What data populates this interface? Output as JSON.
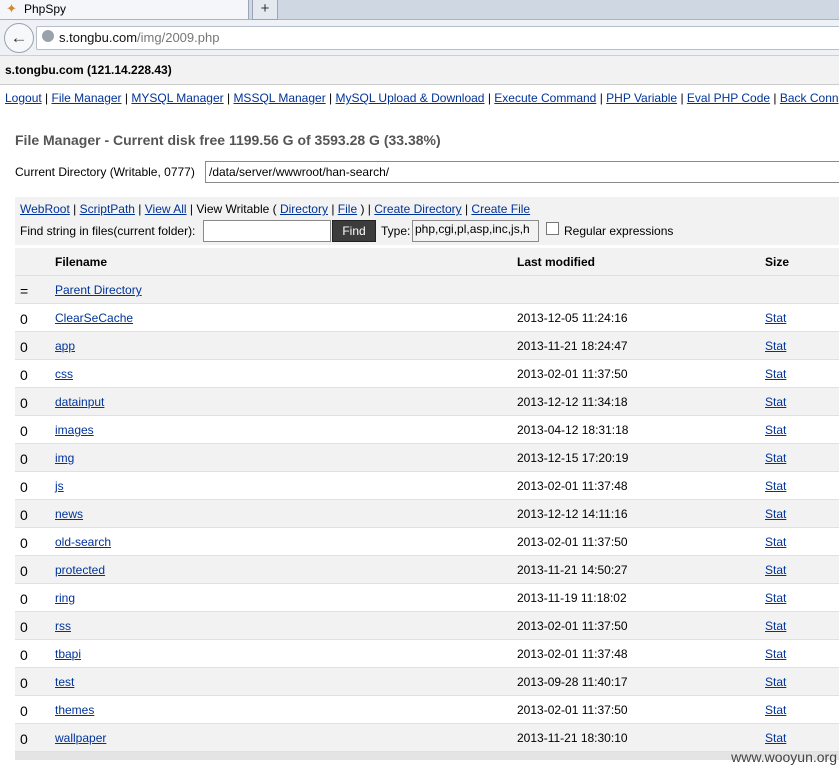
{
  "browser": {
    "tab_title": "PhpSpy",
    "url_host": "s.tongbu.com",
    "url_path": "/img/2009.php"
  },
  "host_info": "s.tongbu.com (121.14.228.43)",
  "menu": [
    "Logout",
    "File Manager",
    "MYSQL Manager",
    "MSSQL Manager",
    "MySQL Upload & Download",
    "Execute Command",
    "PHP Variable",
    "Eval PHP Code",
    "Back Conn"
  ],
  "file_manager": {
    "title": "File Manager - Current disk free 1199.56 G of 3593.28 G (33.38%)",
    "current_dir_label": "Current Directory (Writable, 0777)",
    "current_dir_value": "/data/server/wwwroot/han-search/",
    "tools": {
      "webroot": "WebRoot",
      "scriptpath": "ScriptPath",
      "view_all": "View All",
      "view_writable_prefix": "View Writable (",
      "directory": "Directory",
      "file": "File",
      "view_writable_suffix": ")",
      "create_directory": "Create Directory",
      "create_file": "Create File"
    },
    "find": {
      "label": "Find string in files(current folder):",
      "value": "",
      "button": "Find",
      "type_label": "Type:",
      "type_value": "php,cgi,pl,asp,inc,js,h",
      "regex_label": "Regular expressions",
      "regex_checked": false
    },
    "columns": {
      "filename": "Filename",
      "last_modified": "Last modified",
      "size": "Size"
    },
    "parent": {
      "marker": "=",
      "label": "Parent Directory"
    },
    "rows": [
      {
        "marker": "0",
        "name": "ClearSeCache",
        "modified": "2013-12-05 11:24:16",
        "size": "Stat"
      },
      {
        "marker": "0",
        "name": "app",
        "modified": "2013-11-21 18:24:47",
        "size": "Stat"
      },
      {
        "marker": "0",
        "name": "css",
        "modified": "2013-02-01 11:37:50",
        "size": "Stat"
      },
      {
        "marker": "0",
        "name": "datainput",
        "modified": "2013-12-12 11:34:18",
        "size": "Stat"
      },
      {
        "marker": "0",
        "name": "images",
        "modified": "2013-04-12 18:31:18",
        "size": "Stat"
      },
      {
        "marker": "0",
        "name": "img",
        "modified": "2013-12-15 17:20:19",
        "size": "Stat"
      },
      {
        "marker": "0",
        "name": "js",
        "modified": "2013-02-01 11:37:48",
        "size": "Stat"
      },
      {
        "marker": "0",
        "name": "news",
        "modified": "2013-12-12 14:11:16",
        "size": "Stat"
      },
      {
        "marker": "0",
        "name": "old-search",
        "modified": "2013-02-01 11:37:50",
        "size": "Stat"
      },
      {
        "marker": "0",
        "name": "protected",
        "modified": "2013-11-21 14:50:27",
        "size": "Stat"
      },
      {
        "marker": "0",
        "name": "ring",
        "modified": "2013-11-19 11:18:02",
        "size": "Stat"
      },
      {
        "marker": "0",
        "name": "rss",
        "modified": "2013-02-01 11:37:50",
        "size": "Stat"
      },
      {
        "marker": "0",
        "name": "tbapi",
        "modified": "2013-02-01 11:37:48",
        "size": "Stat"
      },
      {
        "marker": "0",
        "name": "test",
        "modified": "2013-09-28 11:40:17",
        "size": "Stat"
      },
      {
        "marker": "0",
        "name": "themes",
        "modified": "2013-02-01 11:37:50",
        "size": "Stat"
      },
      {
        "marker": "0",
        "name": "wallpaper",
        "modified": "2013-11-21 18:30:10",
        "size": "Stat"
      }
    ]
  },
  "watermark": "www.wooyun.org"
}
